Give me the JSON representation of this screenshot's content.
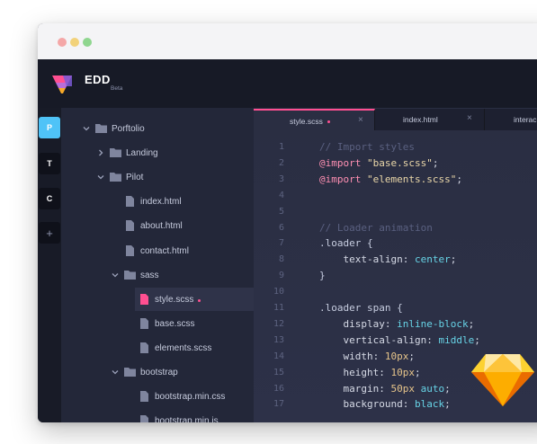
{
  "app": {
    "name": "EDD",
    "badge": "Beta"
  },
  "rail": {
    "items": [
      "P",
      "T",
      "C"
    ],
    "add_label": "+"
  },
  "tree": [
    {
      "label": "Porftolio",
      "type": "folder",
      "expanded": true
    },
    {
      "label": "Landing",
      "type": "folder",
      "expanded": false
    },
    {
      "label": "Pilot",
      "type": "folder",
      "expanded": true
    },
    {
      "label": "index.html",
      "type": "file"
    },
    {
      "label": "about.html",
      "type": "file"
    },
    {
      "label": "contact.html",
      "type": "file"
    },
    {
      "label": "sass",
      "type": "folder",
      "expanded": true
    },
    {
      "label": "style.scss",
      "type": "file",
      "selected": true,
      "modified": true
    },
    {
      "label": "base.scss",
      "type": "file"
    },
    {
      "label": "elements.scss",
      "type": "file"
    },
    {
      "label": "bootstrap",
      "type": "folder",
      "expanded": true
    },
    {
      "label": "bootstrap.min.css",
      "type": "file"
    },
    {
      "label": "bootstrap.min.js",
      "type": "file"
    }
  ],
  "tabs": [
    {
      "label": "style.scss",
      "active": true,
      "modified": true,
      "close": "×"
    },
    {
      "label": "index.html",
      "active": false,
      "close": "×"
    },
    {
      "label": "interac",
      "active": false
    }
  ],
  "code_lines": [
    {
      "n": "1",
      "text": "// Import styles"
    },
    {
      "n": "2",
      "text": "@import \"base.scss\";"
    },
    {
      "n": "3",
      "text": "@import \"elements.scss\";"
    },
    {
      "n": "4",
      "text": ""
    },
    {
      "n": "5",
      "text": ""
    },
    {
      "n": "6",
      "text": "// Loader animation"
    },
    {
      "n": "7",
      "text": ".loader {"
    },
    {
      "n": "8",
      "text": "    text-align: center;"
    },
    {
      "n": "9",
      "text": "}"
    },
    {
      "n": "10",
      "text": ""
    },
    {
      "n": "11",
      "text": ".loader span {"
    },
    {
      "n": "12",
      "text": "    display: inline-block;"
    },
    {
      "n": "13",
      "text": "    vertical-align: middle;"
    },
    {
      "n": "14",
      "text": "    width: 10px;"
    },
    {
      "n": "15",
      "text": "    height: 10px;"
    },
    {
      "n": "16",
      "text": "    margin: 50px auto;"
    },
    {
      "n": "17",
      "text": "    background: black;"
    }
  ],
  "colors": {
    "accent_pink": "#ff4f91",
    "accent_blue": "#4fc3f7",
    "sketch_orange": "#f7a928"
  },
  "icons": [
    "folder-icon",
    "file-icon",
    "chevron-icon",
    "close-icon",
    "sketch-gem-icon",
    "edd-logo-icon"
  ]
}
